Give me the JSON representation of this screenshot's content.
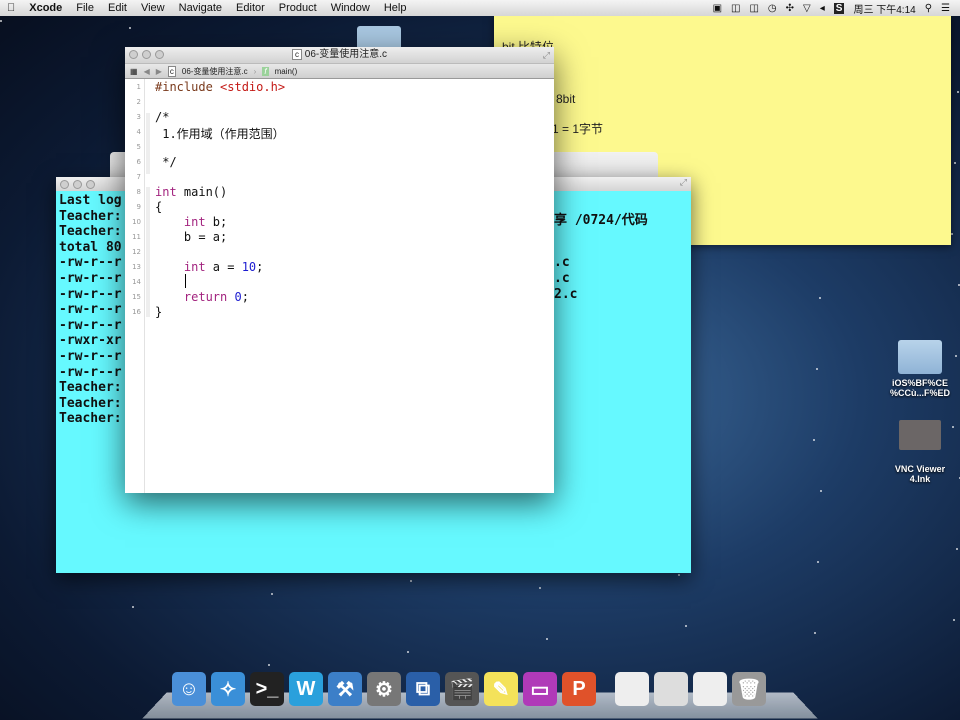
{
  "menubar": {
    "app": "Xcode",
    "items": [
      "File",
      "Edit",
      "View",
      "Navigate",
      "Editor",
      "Product",
      "Window",
      "Help"
    ],
    "clock": "周三 下午4:14"
  },
  "sticky": {
    "lines": [
      "bit 比特位",
      "i",
      "8bit",
      "1 = 1字节"
    ]
  },
  "terminal": {
    "left": [
      "Last log",
      "Teacher:",
      "Teacher:",
      "total 80",
      "-rw-r--r",
      "-rw-r--r",
      "-rw-r--r",
      "-rw-r--r",
      "-rw-r--r",
      "-rwxr-xr",
      "-rw-r--r",
      "-rw-r--r",
      "Teacher:",
      "Teacher:",
      "Teacher:"
    ],
    "right": [
      "",
      "享 /0724/代码",
      "",
      "",
      ".c",
      ".c",
      "2.c",
      "",
      "",
      "",
      "",
      "",
      "",
      "",
      ""
    ],
    "bg": "#66f9ff"
  },
  "xcode": {
    "title": "06-变量使用注意.c",
    "jump_file": "06-变量使用注意.c",
    "jump_symbol": "main()",
    "line_numbers": [
      "1",
      "2",
      "3",
      "4",
      "5",
      "6",
      "7",
      "8",
      "9",
      "10",
      "11",
      "12",
      "13",
      "14",
      "15",
      "16"
    ]
  },
  "code": {
    "l1a": "#include ",
    "l1b": "<stdio.h>",
    "l3": "/*",
    "l4": " 1.作用域（作用范围）",
    "l6": " */",
    "l8a": "int",
    "l8b": " main()",
    "l9": "{",
    "l10a": "    int",
    "l10b": " b;",
    "l11": "    b = a;",
    "l13a": "    int",
    "l13b": " a = ",
    "l13c": "10",
    "l13d": ";",
    "l15a": "    return",
    "l15b": " ",
    "l15c": "0",
    "l15d": ";",
    "l16": "}"
  },
  "desktop": {
    "icons": [
      {
        "label": "iOS%BF%CE\n%CCù...F%ED"
      },
      {
        "label": "VNC Viewer\n4.lnk"
      }
    ]
  },
  "dock": [
    "finder",
    "safari",
    "terminal",
    "word",
    "xcode",
    "system-preferences",
    "vmware",
    "imovie",
    "stickies",
    "imac",
    "powerpoint",
    "word-doc",
    "ppt-doc",
    "finder-doc",
    "trash"
  ]
}
